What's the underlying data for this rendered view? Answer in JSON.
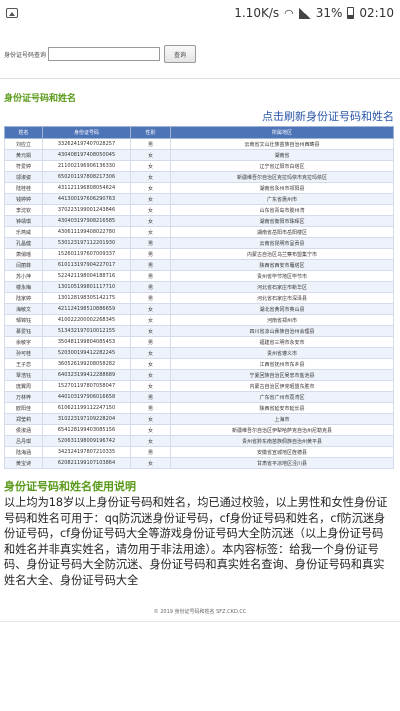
{
  "status_bar": {
    "speed": "1.10K/s",
    "battery": "31%",
    "time": "02:10",
    "icons": [
      "gallery-icon",
      "wifi-icon",
      "signal-icon",
      "battery-icon"
    ]
  },
  "search": {
    "label": "身份证号码查询",
    "input_value": "",
    "button_label": "查询"
  },
  "section_title": "身份证号码和姓名",
  "refresh_link": "点击刷新身份证号码和姓名",
  "table": {
    "headers": [
      "姓名",
      "身份证号码",
      "性别",
      "所属地区"
    ],
    "rows": [
      [
        "刘应立",
        "332624197407028257",
        "男",
        "云南省文山壮族苗族自治州西畴县"
      ],
      [
        "黄元娟",
        "430408197408050045",
        "女",
        "湖南省"
      ],
      [
        "符爱婷",
        "211002196906136330",
        "女",
        "辽宁省辽阳市白塔区"
      ],
      [
        "邬淑姿",
        "650201197808217306",
        "女",
        "新疆维吾尔自治区克拉玛依市克拉玛依区"
      ],
      [
        "陆桂桂",
        "431121196808054624",
        "女",
        "湖南省永州市祁阳县"
      ],
      [
        "钱婷婷",
        "441300197606290763",
        "女",
        "广东省惠州市"
      ],
      [
        "李沈钦",
        "370223199001243846",
        "女",
        "山东省青岛市胶州湾"
      ],
      [
        "钟靖琪",
        "430403197908216585",
        "女",
        "湖南省衡阳市珠晖区"
      ],
      [
        "乐燕威",
        "430611199408022780",
        "女",
        "湖南省岳阳市岳阳楼区"
      ],
      [
        "孔晶健",
        "530123197112201930",
        "男",
        "云南省昆明市呈贡县"
      ],
      [
        "萧俏瑶",
        "152601197607009337",
        "男",
        "内蒙古自治区乌兰察布盟集宁市"
      ],
      [
        "闫丽菲",
        "610113197904227017",
        "男",
        "陕西省西安市雁塔区"
      ],
      [
        "苏小萍",
        "522421198004188716",
        "男",
        "贵州省毕节地区毕节市"
      ],
      [
        "楼永梅",
        "130105199801117710",
        "男",
        "河北省石家庄市新华区"
      ],
      [
        "陆家婷",
        "130128198305142175",
        "男",
        "河北省石家庄市深泽县"
      ],
      [
        "海敏文",
        "421124198510886659",
        "女",
        "湖北省黄冈市英山县"
      ],
      [
        "邹锦钰",
        "410022200002268345",
        "女",
        "河南省郑州市"
      ],
      [
        "慕爱钰",
        "513432197010012155",
        "女",
        "四川省凉山彝族自治州会理县"
      ],
      [
        "余敏宇",
        "350481199804085453",
        "男",
        "福建省三明市永安市"
      ],
      [
        "孙可桂",
        "520300199412282245",
        "女",
        "贵州省遵义市"
      ],
      [
        "王子恋",
        "360526199208058282",
        "女",
        "江西省抚州市东乡县"
      ],
      [
        "覃浩钰",
        "640323199412288689",
        "女",
        "宁夏回族自治区吴忠市盐池县"
      ],
      [
        "庞翼周",
        "152701197807058047",
        "女",
        "内蒙古自治区伊克昭盟东胜市"
      ],
      [
        "万林梓",
        "440103197906016658",
        "男",
        "广东省广州市荔湾区"
      ],
      [
        "欧阳佳",
        "610621199112247150",
        "男",
        "陕西省延安市延长县"
      ],
      [
        "郑莹莉",
        "310223197109228204",
        "女",
        "上海市"
      ],
      [
        "侯淑涵",
        "654128199403085156",
        "女",
        "新疆维吾尔自治区伊犁哈萨克自治州尼勒克县"
      ],
      [
        "吕丹琪",
        "520631198009196742",
        "女",
        "贵州省黔东南苗族侗族自治州黄平县"
      ],
      [
        "陆海涵",
        "342324197807210335",
        "男",
        "安徽省宣城地区旌德县"
      ],
      [
        "黄宝诗",
        "620821199107103864",
        "女",
        "甘肃省平凉地区泾川县"
      ]
    ]
  },
  "usage": {
    "title": "身份证号码和姓名使用说明",
    "text": "以上均为18岁以上身份证号码和姓名，均已通过校验，以上男性和女性身份证号码和姓名可用于：qq防沉迷身份证号码，cf身份证号码和姓名，cf防沉迷身份证号码，cf身份证号码大全等游戏身份证号码大全防沉迷（以上身份证号码和姓名并非真实姓名，请勿用于非法用途）。本内容标签：给我一个身份证号码、身份证号码大全防沉迷、身份证号码和真实姓名查询、身份证号码和真实姓名大全、身份证号码大全"
  },
  "footer": "© 2019 身份证号码和姓名 SFZ.CKD.CC"
}
